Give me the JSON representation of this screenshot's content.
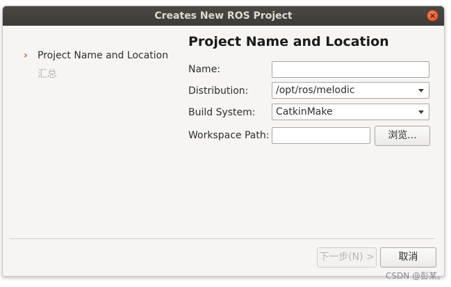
{
  "window": {
    "title": "Creates New ROS Project",
    "close_glyph": "×"
  },
  "steps": [
    {
      "label": "Project Name and Location",
      "active": true
    },
    {
      "label": "汇总",
      "active": false
    }
  ],
  "step_arrow_glyph": "›",
  "main": {
    "title": "Project Name and Location",
    "name_label": "Name:",
    "name_value": "",
    "distribution_label": "Distribution:",
    "distribution_value": "/opt/ros/melodic",
    "build_label": "Build System:",
    "build_value": "CatkinMake",
    "workspace_label": "Workspace Path:",
    "workspace_value": "",
    "browse_label": "浏览..."
  },
  "footer": {
    "next_label": "下一步(N) >",
    "cancel_label": "取消"
  },
  "watermark": "CSDN @彭某。",
  "colors": {
    "accent": "#e95420",
    "titlebar": "#3c3b37",
    "dialog_bg": "#f6f5f4"
  },
  "icons": {
    "close": "close-icon",
    "step_arrow": "chevron-right-icon",
    "dropdown": "chevron-down-icon"
  }
}
